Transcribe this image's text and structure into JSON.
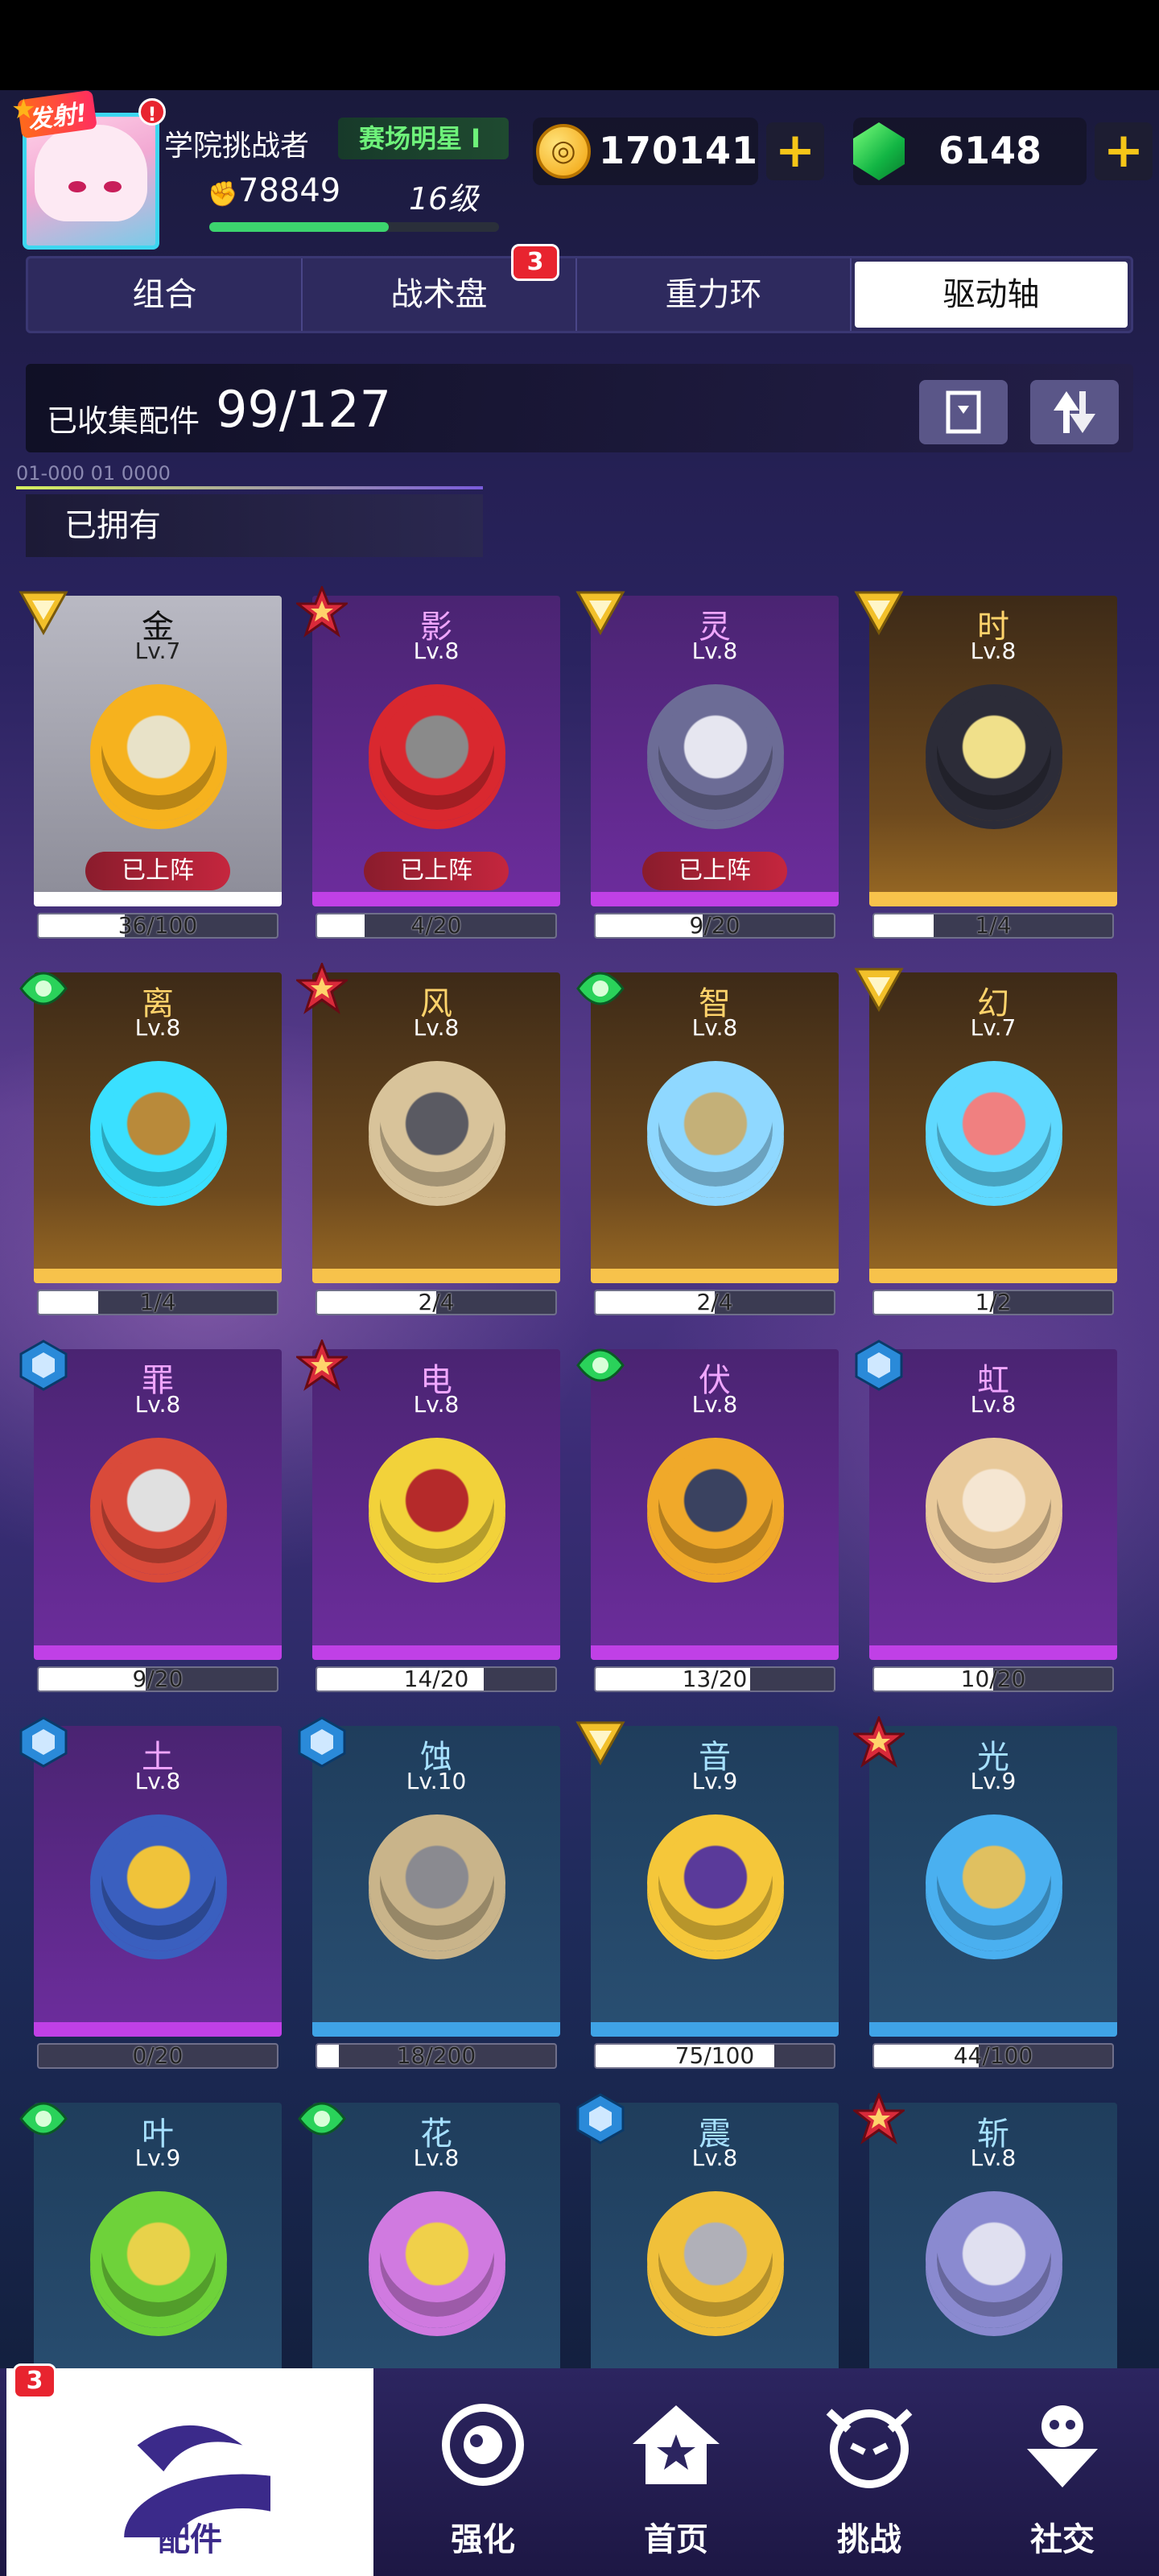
{
  "header": {
    "fire_badge": "发射!",
    "alert": "!",
    "player_name": "学院挑战者",
    "title_badge": "赛场明星 I",
    "power": "78849",
    "level": "16级",
    "coins": "170141",
    "gems": "6148",
    "xp_progress": 0.62
  },
  "tabs": [
    {
      "label": "组合",
      "badge": ""
    },
    {
      "label": "战术盘",
      "badge": "3"
    },
    {
      "label": "重力环",
      "badge": ""
    },
    {
      "label": "驱动轴",
      "badge": ""
    }
  ],
  "active_tab": 3,
  "collection": {
    "label": "已收集配件",
    "value": "99/127",
    "filter_code": "01-000 01 0000",
    "filter_label": "已拥有"
  },
  "deployed_label": "已上阵",
  "parts": [
    {
      "name": "金",
      "lv": "Lv.7",
      "rarity": "silver",
      "badge": "attack",
      "deployed": true,
      "progress": "36/100",
      "frac": 0.36,
      "colors": [
        "#f6b21e",
        "#e8e2c8"
      ]
    },
    {
      "name": "影",
      "lv": "Lv.8",
      "rarity": "purple",
      "badge": "star",
      "deployed": true,
      "progress": "4/20",
      "frac": 0.2,
      "colors": [
        "#d9282f",
        "#8a8a8a"
      ]
    },
    {
      "name": "灵",
      "lv": "Lv.8",
      "rarity": "purple",
      "badge": "attack",
      "deployed": true,
      "progress": "9/20",
      "frac": 0.45,
      "colors": [
        "#6c6c96",
        "#e6e6f0"
      ]
    },
    {
      "name": "时",
      "lv": "Lv.8",
      "rarity": "gold",
      "badge": "attack",
      "deployed": false,
      "progress": "1/4",
      "frac": 0.25,
      "colors": [
        "#2c2c38",
        "#f0e08a"
      ]
    },
    {
      "name": "离",
      "lv": "Lv.8",
      "rarity": "gold",
      "badge": "balance",
      "deployed": false,
      "progress": "1/4",
      "frac": 0.25,
      "colors": [
        "#3ae0ff",
        "#b98a3a"
      ]
    },
    {
      "name": "风",
      "lv": "Lv.8",
      "rarity": "gold",
      "badge": "star",
      "deployed": false,
      "progress": "2/4",
      "frac": 0.5,
      "colors": [
        "#d8c39a",
        "#5a5a62"
      ]
    },
    {
      "name": "智",
      "lv": "Lv.8",
      "rarity": "gold",
      "badge": "balance",
      "deployed": false,
      "progress": "2/4",
      "frac": 0.5,
      "colors": [
        "#8fd8ff",
        "#c4b078"
      ]
    },
    {
      "name": "幻",
      "lv": "Lv.7",
      "rarity": "gold",
      "badge": "attack",
      "deployed": false,
      "progress": "1/2",
      "frac": 0.5,
      "colors": [
        "#5fd9ff",
        "#f08080"
      ]
    },
    {
      "name": "罪",
      "lv": "Lv.8",
      "rarity": "purple",
      "badge": "defense",
      "deployed": false,
      "progress": "9/20",
      "frac": 0.45,
      "colors": [
        "#d94a3a",
        "#e0e0e0"
      ]
    },
    {
      "name": "电",
      "lv": "Lv.8",
      "rarity": "purple",
      "badge": "star",
      "deployed": false,
      "progress": "14/20",
      "frac": 0.7,
      "colors": [
        "#f2d23a",
        "#b52a2a"
      ]
    },
    {
      "name": "伏",
      "lv": "Lv.8",
      "rarity": "purple",
      "badge": "balance",
      "deployed": false,
      "progress": "13/20",
      "frac": 0.65,
      "colors": [
        "#f0a92a",
        "#3a4260"
      ]
    },
    {
      "name": "虹",
      "lv": "Lv.8",
      "rarity": "purple",
      "badge": "defense",
      "deployed": false,
      "progress": "10/20",
      "frac": 0.5,
      "colors": [
        "#e8c99a",
        "#f5e6d2"
      ]
    },
    {
      "name": "土",
      "lv": "Lv.8",
      "rarity": "purple",
      "badge": "defense",
      "deployed": false,
      "progress": "0/20",
      "frac": 0.0,
      "colors": [
        "#3a5fbf",
        "#f0c33a"
      ]
    },
    {
      "name": "蚀",
      "lv": "Lv.10",
      "rarity": "blue",
      "badge": "defense",
      "deployed": false,
      "progress": "18/200",
      "frac": 0.09,
      "colors": [
        "#c9b48a",
        "#8a8a90"
      ]
    },
    {
      "name": "音",
      "lv": "Lv.9",
      "rarity": "blue",
      "badge": "attack",
      "deployed": false,
      "progress": "75/100",
      "frac": 0.75,
      "colors": [
        "#f5c73a",
        "#5a3a9a"
      ]
    },
    {
      "name": "光",
      "lv": "Lv.9",
      "rarity": "blue",
      "badge": "star",
      "deployed": false,
      "progress": "44/100",
      "frac": 0.44,
      "colors": [
        "#4ab0f0",
        "#e0c060"
      ]
    },
    {
      "name": "叶",
      "lv": "Lv.9",
      "rarity": "blue",
      "badge": "balance",
      "deployed": false,
      "progress": "",
      "frac": 0,
      "colors": [
        "#6ed23a",
        "#e8d24a"
      ]
    },
    {
      "name": "花",
      "lv": "Lv.8",
      "rarity": "blue",
      "badge": "balance",
      "deployed": false,
      "progress": "",
      "frac": 0,
      "colors": [
        "#d07ae0",
        "#f0d04a"
      ]
    },
    {
      "name": "震",
      "lv": "Lv.8",
      "rarity": "blue",
      "badge": "defense",
      "deployed": false,
      "progress": "",
      "frac": 0,
      "colors": [
        "#f0c03a",
        "#b0b0b8"
      ]
    },
    {
      "name": "斩",
      "lv": "Lv.8",
      "rarity": "blue",
      "badge": "star",
      "deployed": false,
      "progress": "",
      "frac": 0,
      "colors": [
        "#8a8ad0",
        "#e0e0f0"
      ]
    }
  ],
  "badge_colors": {
    "attack": "#f2c02a",
    "star": "#d92a3a",
    "balance": "#2ad25a",
    "defense": "#2a8ad9"
  },
  "nav": [
    {
      "label": "配件",
      "badge": "3",
      "icon": "parts-icon",
      "active": true
    },
    {
      "label": "强化",
      "badge": "",
      "icon": "enhance-icon",
      "active": false
    },
    {
      "label": "首页",
      "badge": "",
      "icon": "home-icon",
      "active": false
    },
    {
      "label": "挑战",
      "badge": "",
      "icon": "challenge-icon",
      "active": false
    },
    {
      "label": "社交",
      "badge": "",
      "icon": "social-icon",
      "active": false
    }
  ]
}
